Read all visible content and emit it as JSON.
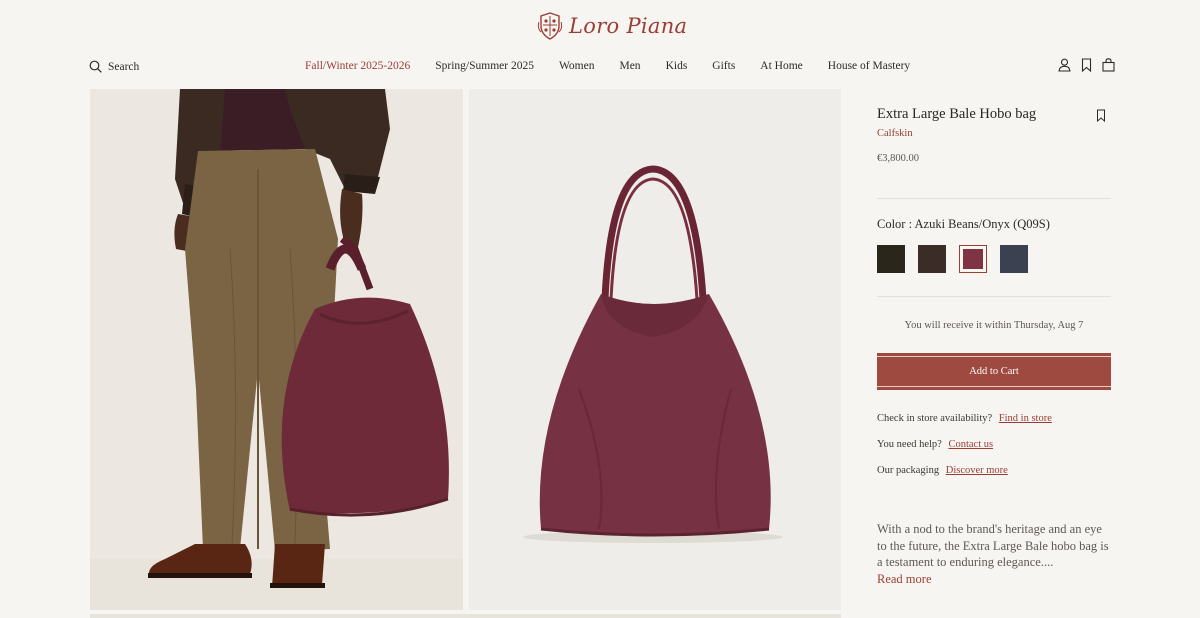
{
  "brand": {
    "name": "Loro Piana"
  },
  "header": {
    "search_label": "Search",
    "nav": [
      {
        "label": "Fall/Winter 2025-2026",
        "active": true
      },
      {
        "label": "Spring/Summer 2025"
      },
      {
        "label": "Women"
      },
      {
        "label": "Men"
      },
      {
        "label": "Kids"
      },
      {
        "label": "Gifts"
      },
      {
        "label": "At Home"
      },
      {
        "label": "House of Mastery"
      }
    ],
    "icons": [
      "account-icon",
      "wishlist-icon",
      "bag-icon"
    ]
  },
  "product": {
    "title": "Extra Large Bale Hobo bag",
    "material": "Calfskin",
    "price": "€3,800.00",
    "color_label": "Color : Azuki Beans/Onyx (Q09S)",
    "swatches": [
      {
        "color": "#2a261c"
      },
      {
        "color": "#3a2c27"
      },
      {
        "color": "#7e3444",
        "selected": true
      },
      {
        "color": "#3b4150"
      }
    ],
    "delivery": "You will receive it within Thursday, Aug 7",
    "add_to_cart": "Add to Cart",
    "store": {
      "text": "Check in store availability?",
      "link": "Find in store"
    },
    "help": {
      "text": "You need help?",
      "link": "Contact us"
    },
    "packaging": {
      "text": "Our packaging",
      "link": "Discover more"
    },
    "description": "With a nod to the brand's heritage and an eye to the future, the Extra Large Bale hobo bag is a testament to enduring elegance....",
    "read_more": "Read more"
  },
  "colors": {
    "accent": "#9b3e35",
    "button": "#9e4a40",
    "background": "#f7f5f1"
  }
}
